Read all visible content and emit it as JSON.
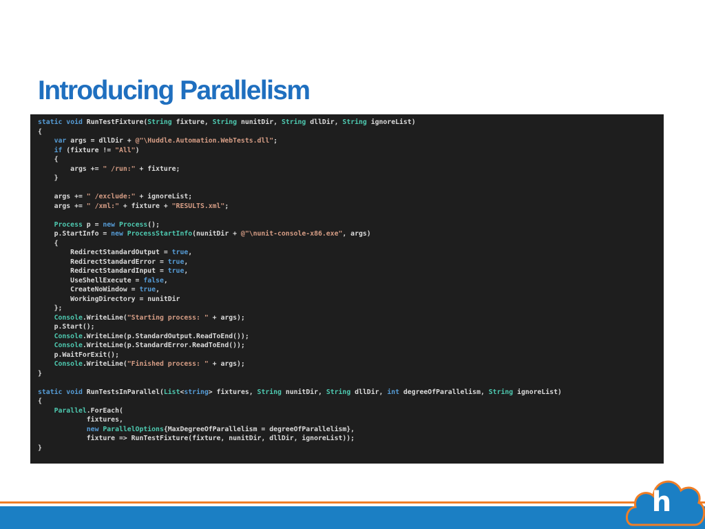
{
  "slide": {
    "title": "Introducing Parallelism"
  },
  "code": {
    "lines": [
      [
        [
          "kw",
          "static "
        ],
        [
          "kw",
          "void "
        ],
        [
          "",
          "RunTestFixture("
        ],
        [
          "ty",
          "String"
        ],
        [
          "",
          " fixture, "
        ],
        [
          "ty",
          "String"
        ],
        [
          "",
          " nunitDir, "
        ],
        [
          "ty",
          "String"
        ],
        [
          "",
          " dllDir, "
        ],
        [
          "ty",
          "String"
        ],
        [
          "",
          " ignoreList)"
        ]
      ],
      [
        [
          "",
          "{"
        ]
      ],
      [
        [
          "",
          "    "
        ],
        [
          "kw",
          "var"
        ],
        [
          "",
          " args = dllDir + "
        ],
        [
          "str",
          "@\"\\Huddle.Automation.WebTests.dll\""
        ],
        [
          "",
          ";"
        ]
      ],
      [
        [
          "",
          "    "
        ],
        [
          "kw",
          "if"
        ],
        [
          "",
          " (fixture != "
        ],
        [
          "str",
          "\"All\""
        ],
        [
          "",
          ")"
        ]
      ],
      [
        [
          "",
          "    {"
        ]
      ],
      [
        [
          "",
          "        args += "
        ],
        [
          "str",
          "\" /run:\""
        ],
        [
          "",
          " + fixture;"
        ]
      ],
      [
        [
          "",
          "    }"
        ]
      ],
      [
        [
          "",
          ""
        ]
      ],
      [
        [
          "",
          "    args += "
        ],
        [
          "str",
          "\" /exclude:\""
        ],
        [
          "",
          " + ignoreList;"
        ]
      ],
      [
        [
          "",
          "    args += "
        ],
        [
          "str",
          "\" /xml:\""
        ],
        [
          "",
          " + fixture + "
        ],
        [
          "str",
          "\"RESULTS.xml\""
        ],
        [
          "",
          ";"
        ]
      ],
      [
        [
          "",
          ""
        ]
      ],
      [
        [
          "",
          "    "
        ],
        [
          "ty",
          "Process"
        ],
        [
          "",
          " p = "
        ],
        [
          "kw",
          "new "
        ],
        [
          "ty",
          "Process"
        ],
        [
          "",
          "();"
        ]
      ],
      [
        [
          "",
          "    p.StartInfo = "
        ],
        [
          "kw",
          "new "
        ],
        [
          "ty",
          "ProcessStartInfo"
        ],
        [
          "",
          "(nunitDir + "
        ],
        [
          "str",
          "@\"\\nunit-console-x86.exe\""
        ],
        [
          "",
          ", args)"
        ]
      ],
      [
        [
          "",
          "    {"
        ]
      ],
      [
        [
          "",
          "        RedirectStandardOutput = "
        ],
        [
          "kw",
          "true"
        ],
        [
          "",
          ","
        ]
      ],
      [
        [
          "",
          "        RedirectStandardError = "
        ],
        [
          "kw",
          "true"
        ],
        [
          "",
          ","
        ]
      ],
      [
        [
          "",
          "        RedirectStandardInput = "
        ],
        [
          "kw",
          "true"
        ],
        [
          "",
          ","
        ]
      ],
      [
        [
          "",
          "        UseShellExecute = "
        ],
        [
          "kw",
          "false"
        ],
        [
          "",
          ","
        ]
      ],
      [
        [
          "",
          "        CreateNoWindow = "
        ],
        [
          "kw",
          "true"
        ],
        [
          "",
          ","
        ]
      ],
      [
        [
          "",
          "        WorkingDirectory = nunitDir"
        ]
      ],
      [
        [
          "",
          "    };"
        ]
      ],
      [
        [
          "",
          "    "
        ],
        [
          "ty",
          "Console"
        ],
        [
          "",
          ".WriteLine("
        ],
        [
          "str",
          "\"Starting process: \""
        ],
        [
          "",
          " + args);"
        ]
      ],
      [
        [
          "",
          "    p.Start();"
        ]
      ],
      [
        [
          "",
          "    "
        ],
        [
          "ty",
          "Console"
        ],
        [
          "",
          ".WriteLine(p.StandardOutput.ReadToEnd());"
        ]
      ],
      [
        [
          "",
          "    "
        ],
        [
          "ty",
          "Console"
        ],
        [
          "",
          ".WriteLine(p.StandardError.ReadToEnd());"
        ]
      ],
      [
        [
          "",
          "    p.WaitForExit();"
        ]
      ],
      [
        [
          "",
          "    "
        ],
        [
          "ty",
          "Console"
        ],
        [
          "",
          ".WriteLine("
        ],
        [
          "str",
          "\"Finished process: \""
        ],
        [
          "",
          " + args);"
        ]
      ],
      [
        [
          "",
          "}"
        ]
      ],
      [
        [
          "",
          ""
        ]
      ],
      [
        [
          "kw",
          "static "
        ],
        [
          "kw",
          "void "
        ],
        [
          "",
          "RunTestsInParallel("
        ],
        [
          "ty",
          "List"
        ],
        [
          "",
          "<"
        ],
        [
          "kw",
          "string"
        ],
        [
          "",
          "> fixtures, "
        ],
        [
          "ty",
          "String"
        ],
        [
          "",
          " nunitDir, "
        ],
        [
          "ty",
          "String"
        ],
        [
          "",
          " dllDir, "
        ],
        [
          "kw",
          "int"
        ],
        [
          "",
          " degreeOfParallelism, "
        ],
        [
          "ty",
          "String"
        ],
        [
          "",
          " ignoreList)"
        ]
      ],
      [
        [
          "",
          "{"
        ]
      ],
      [
        [
          "",
          "    "
        ],
        [
          "ty",
          "Parallel"
        ],
        [
          "",
          ".ForEach("
        ]
      ],
      [
        [
          "",
          "            fixtures,"
        ]
      ],
      [
        [
          "",
          "            "
        ],
        [
          "kw",
          "new "
        ],
        [
          "ty",
          "ParallelOptions"
        ],
        [
          "",
          "{MaxDegreeOfParallelism = degreeOfParallelism},"
        ]
      ],
      [
        [
          "",
          "            fixture => RunTestFixture(fixture, nunitDir, dllDir, ignoreList));"
        ]
      ],
      [
        [
          "",
          "}"
        ]
      ]
    ]
  },
  "logo": {
    "letter": "h",
    "icon": "huddle-cloud-logo"
  },
  "colors": {
    "title": "#1f6fbf",
    "code_background": "#1e1e1e",
    "footer_blue": "#1b7fc4",
    "footer_orange": "#f07e26"
  }
}
